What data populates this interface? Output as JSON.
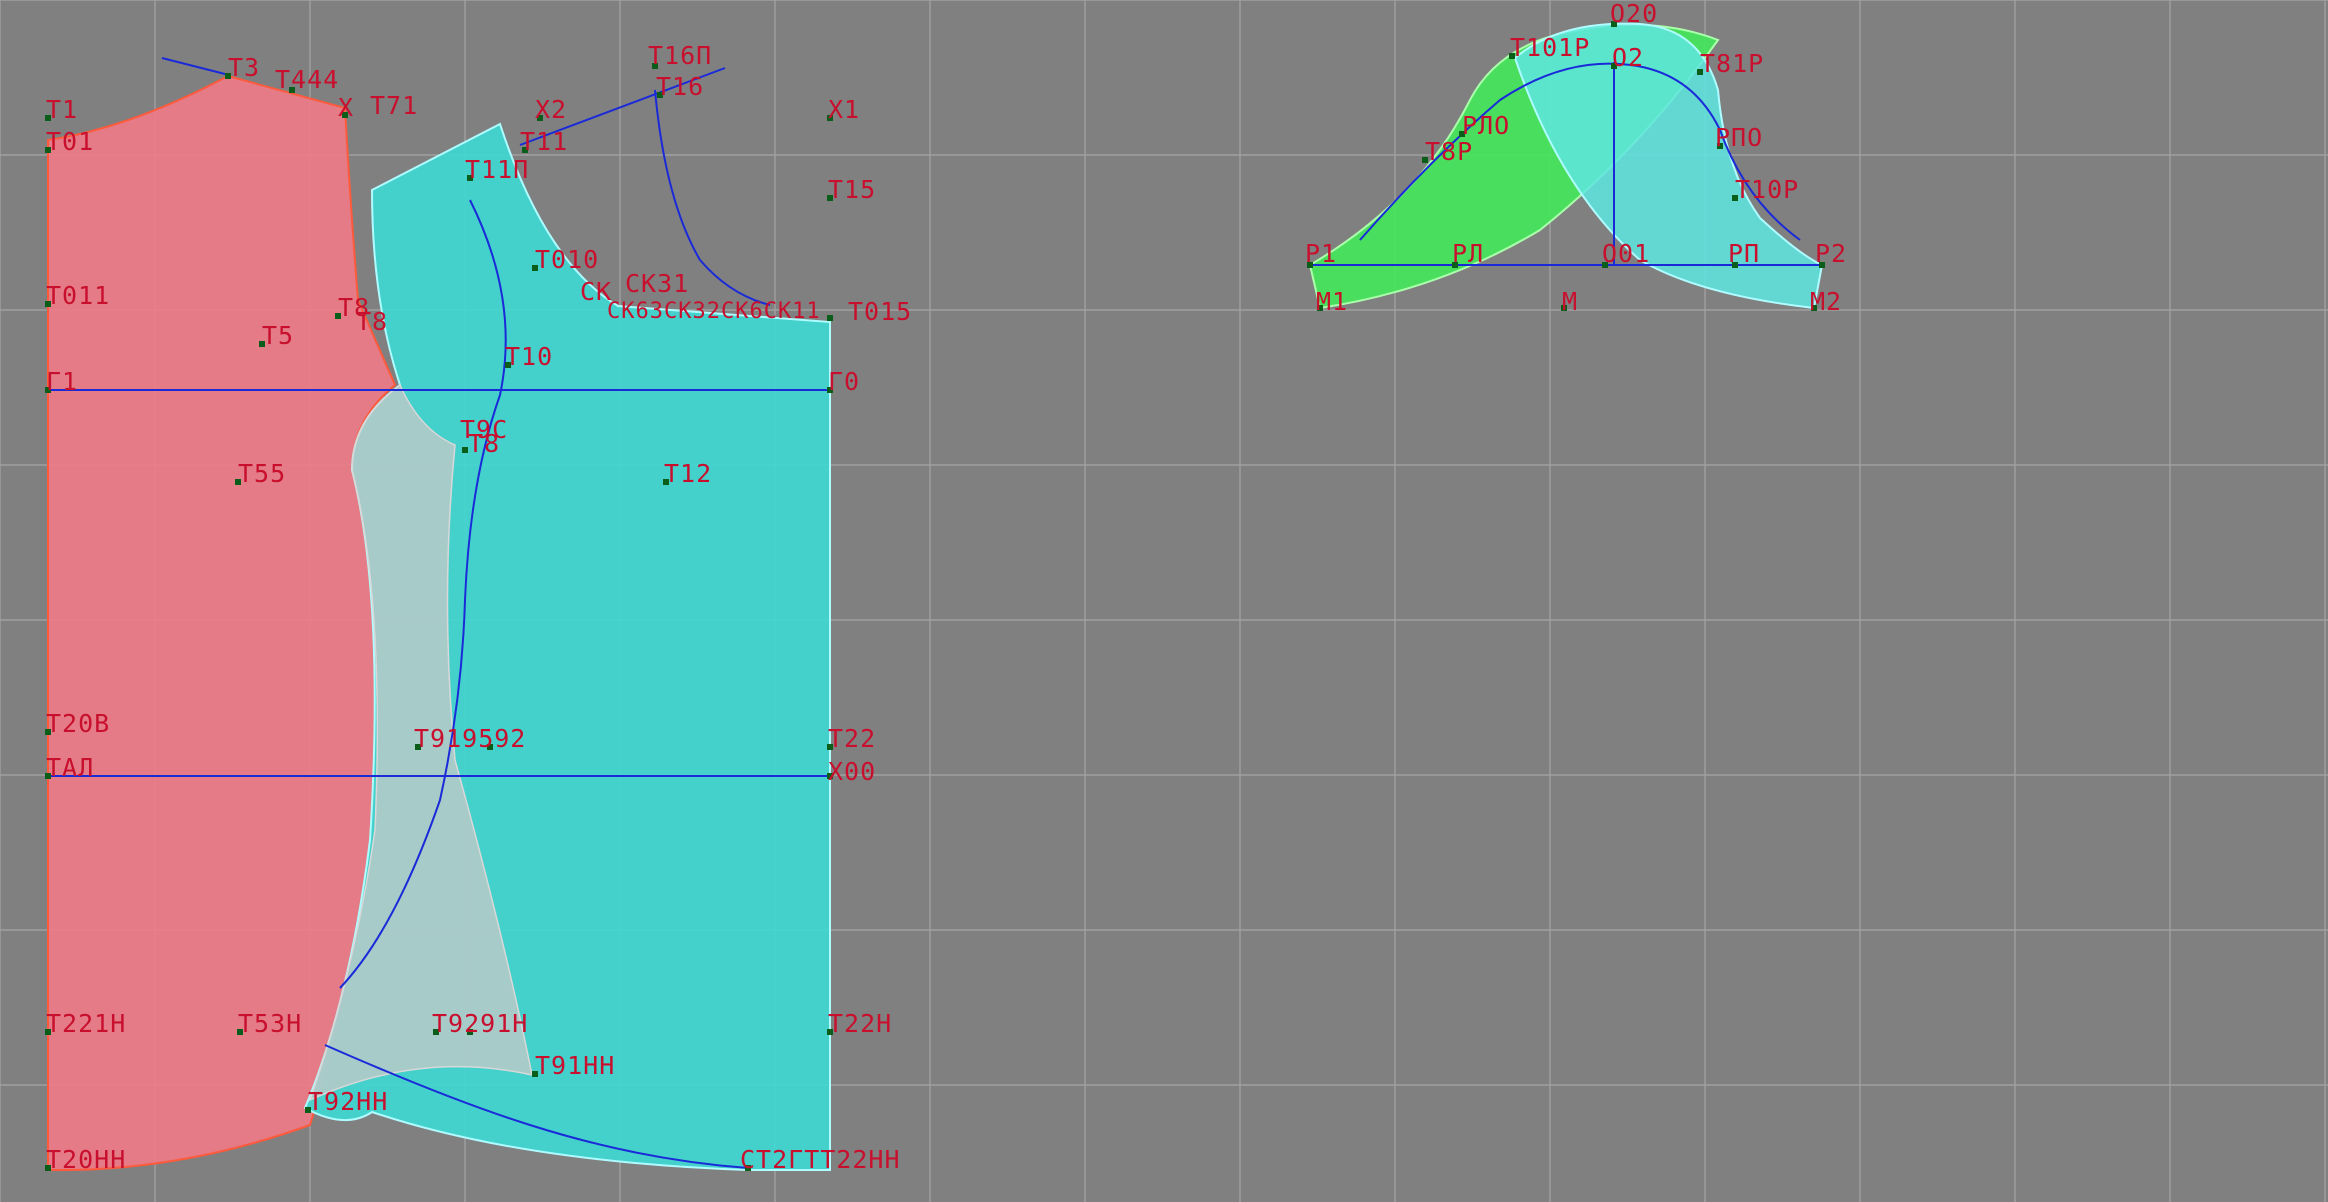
{
  "colors": {
    "background": "#808080",
    "grid": "#a0a0a0",
    "label": "#c8102e",
    "front_fill": "#f07a86",
    "front_outline": "#ff5a3c",
    "back_fill": "#3fd8d2",
    "back_outline": "#aefcff",
    "sleeve_green": "#44e85a",
    "sleeve_cyan": "#5ee6e0",
    "construction_line": "#1a2ad8",
    "point": "#0b5e1a"
  },
  "labels": {
    "t1": "T1",
    "t01": "T01",
    "t011": "T011",
    "t3": "T3",
    "t44": "T444",
    "x_small": "X",
    "t71": "T71",
    "x2": "X2",
    "t11": "T11",
    "t16p": "T16П",
    "t16": "T16",
    "x1": "X1",
    "t15": "T15",
    "t11p": "T11П",
    "t010": "T010",
    "sk": "СК",
    "ck31": "СК31",
    "skrow": "СК63СК32СК6СК11",
    "t015": "T015",
    "t8a": "T8",
    "t8b": "T8",
    "t5": "T5",
    "t10": "T10",
    "g1": "Г1",
    "g0": "Г0",
    "t9c": "T9C",
    "t8c": "T8",
    "t55": "T55",
    "t12": "T12",
    "t20v": "T20В",
    "t919": "T919592",
    "t22": "T22",
    "tal": "TАЛ",
    "x00": "X00",
    "t21n": "T221H",
    "t53n": "T53H",
    "t929": "T9291H",
    "t22n": "T22H",
    "t91nn": "T91HH",
    "t92nn": "T92HH",
    "t20nn": "T20HH",
    "t122nn": "СТ2ГТТ22HH",
    "o20": "O20",
    "t101p": "T101P",
    "o2": "O2",
    "t81p": "T81P",
    "rlo": "РЛО",
    "t8p": "T8P",
    "rpo": "РПО",
    "t10r": "T10P",
    "r1": "P1",
    "rl": "РЛ",
    "o01": "O01",
    "rp": "РП",
    "r2": "P2",
    "m1": "M1",
    "m": "M",
    "m2": "M2"
  }
}
